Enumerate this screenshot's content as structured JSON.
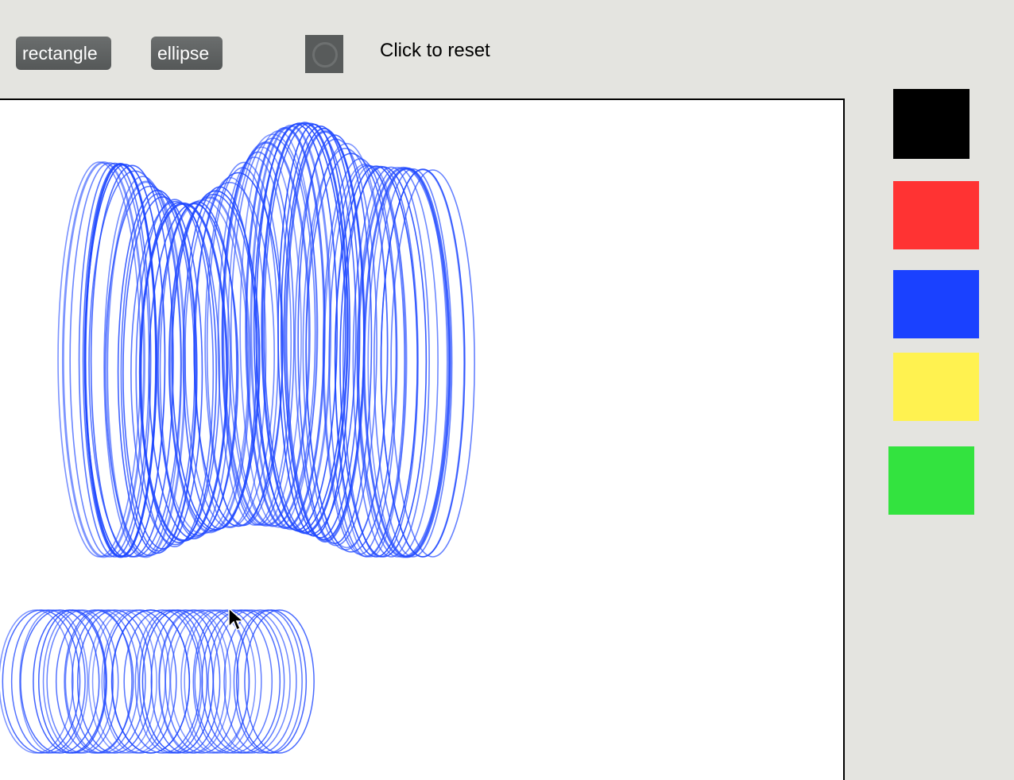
{
  "toolbar": {
    "rectangle_label": "rectangle",
    "ellipse_label": "ellipse",
    "reset_label": "Click to reset"
  },
  "palette": {
    "colors": [
      "#000000",
      "#ff3333",
      "#1a41ff",
      "#fff250",
      "#33e33f"
    ]
  },
  "drawing": {
    "stroke_color": "#1e47ff"
  }
}
